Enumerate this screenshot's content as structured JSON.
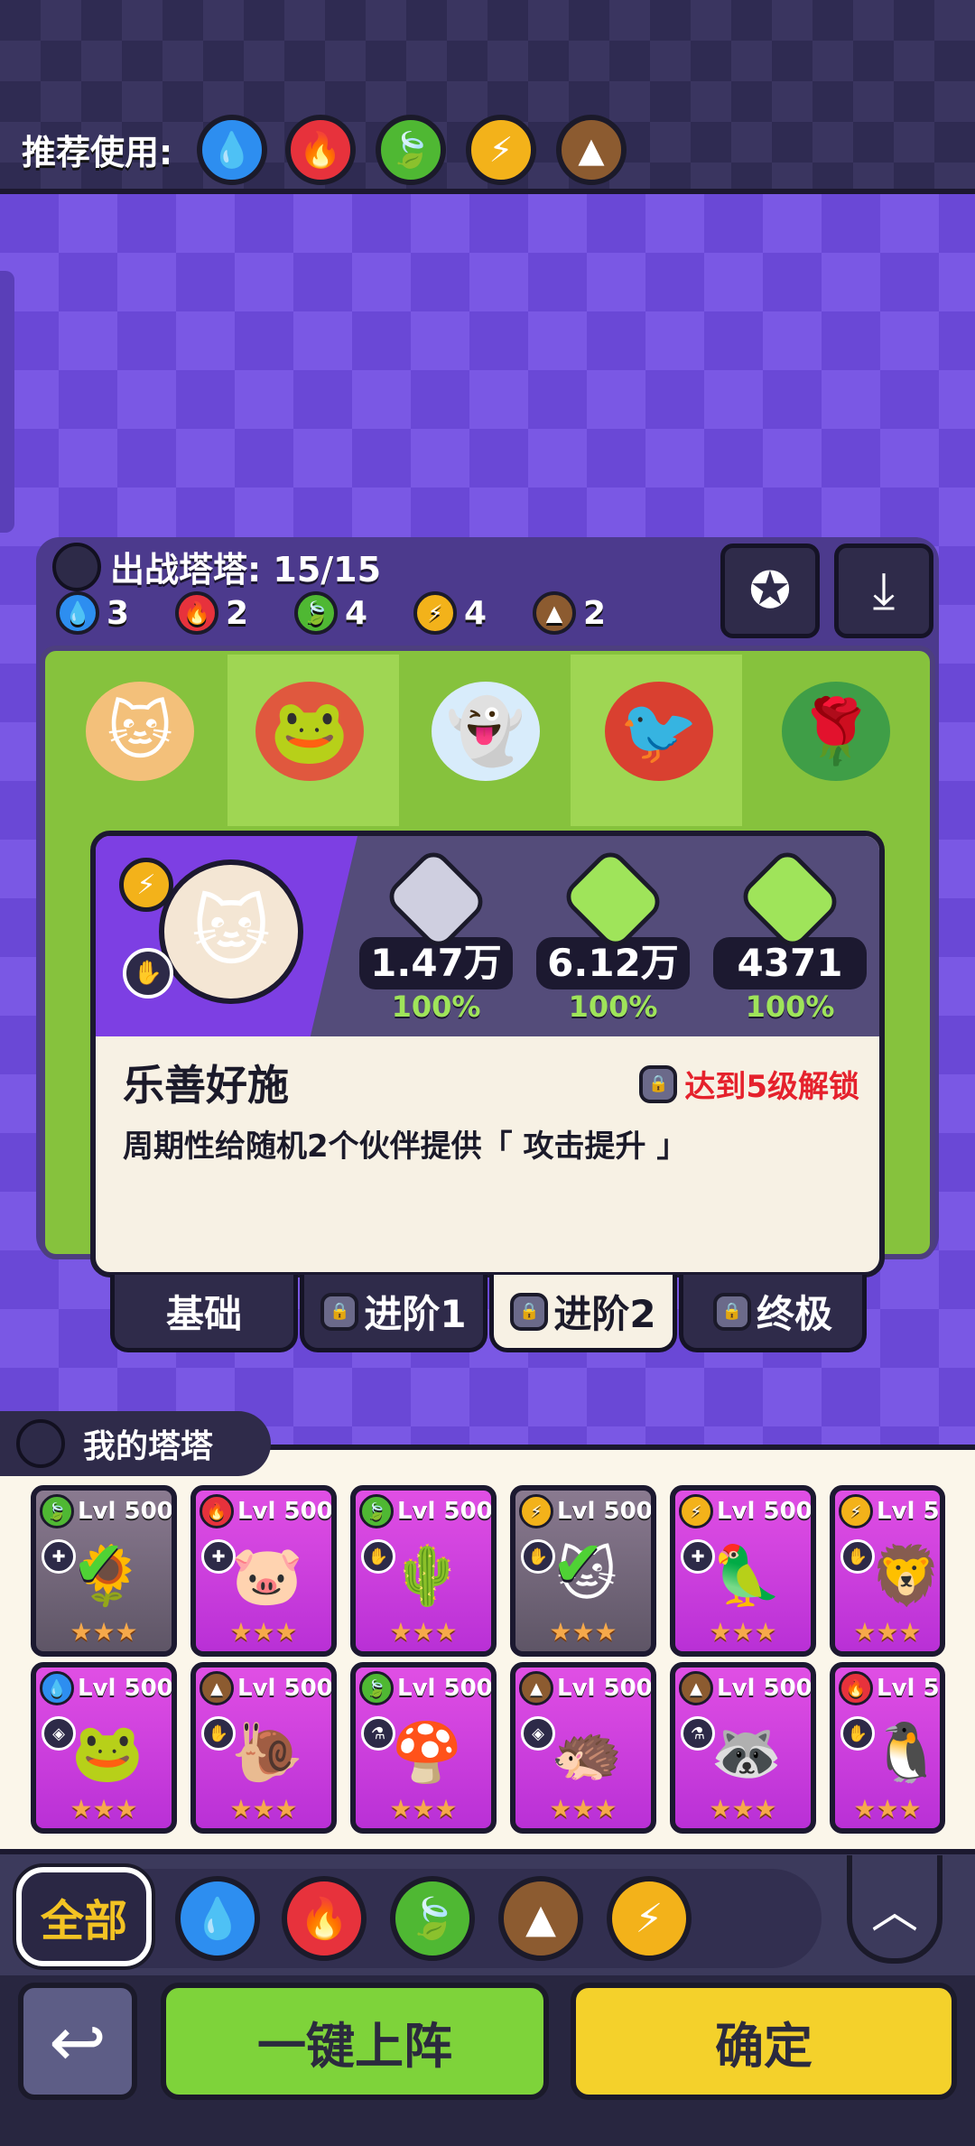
{
  "recommend": {
    "label": "推荐使用:",
    "elements": [
      "water",
      "fire",
      "leaf",
      "lightning",
      "earth"
    ]
  },
  "team": {
    "title": "出战塔塔: 15/15",
    "counts": [
      {
        "element": "water",
        "count": "3"
      },
      {
        "element": "fire",
        "count": "2"
      },
      {
        "element": "leaf",
        "count": "4"
      },
      {
        "element": "lightning",
        "count": "4"
      },
      {
        "element": "earth",
        "count": "2"
      }
    ]
  },
  "info": {
    "stats": [
      {
        "icon": "sword-icon",
        "value": "1.47万",
        "pct": "100%"
      },
      {
        "icon": "heart-icon",
        "value": "6.12万",
        "pct": "100%"
      },
      {
        "icon": "shield-icon",
        "value": "4371",
        "pct": "100%"
      }
    ],
    "skill_name": "乐善好施",
    "lock_text": "达到5级解锁",
    "skill_desc": "周期性给随机2个伙伴提供「 攻击提升 」"
  },
  "tabs": [
    {
      "label": "基础",
      "locked": false
    },
    {
      "label": "进阶1",
      "locked": true
    },
    {
      "label": "进阶2",
      "locked": true
    },
    {
      "label": "终极",
      "locked": true
    }
  ],
  "my_towers": {
    "title": "我的塔塔",
    "cards": [
      {
        "lvl": "Lvl 500",
        "element": "leaf",
        "used": true
      },
      {
        "lvl": "Lvl 500",
        "element": "fire",
        "used": false
      },
      {
        "lvl": "Lvl 500",
        "element": "leaf",
        "used": false
      },
      {
        "lvl": "Lvl 500",
        "element": "lightning",
        "used": true
      },
      {
        "lvl": "Lvl 500",
        "element": "lightning",
        "used": false
      },
      {
        "lvl": "Lvl 5",
        "element": "lightning",
        "used": false
      },
      {
        "lvl": "Lvl 500",
        "element": "water",
        "used": false
      },
      {
        "lvl": "Lvl 500",
        "element": "earth",
        "used": false
      },
      {
        "lvl": "Lvl 500",
        "element": "leaf",
        "used": false
      },
      {
        "lvl": "Lvl 500",
        "element": "earth",
        "used": false
      },
      {
        "lvl": "Lvl 500",
        "element": "earth",
        "used": false
      },
      {
        "lvl": "Lvl 5",
        "element": "fire",
        "used": false
      }
    ]
  },
  "filter": {
    "all_label": "全部",
    "elements": [
      "water",
      "fire",
      "leaf",
      "earth",
      "lightning"
    ]
  },
  "actions": {
    "deploy": "一键上阵",
    "confirm": "确定"
  },
  "colors": {
    "water": "#2d8ef0",
    "fire": "#e7323c",
    "leaf": "#4fb833",
    "lightning": "#f3b21a",
    "earth": "#8c5b30"
  }
}
